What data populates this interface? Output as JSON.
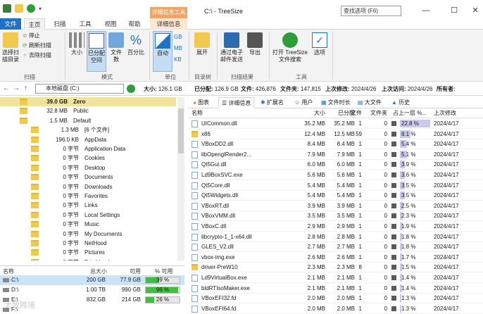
{
  "window": {
    "context_tab_title": "详细信息工具",
    "title": "C:\\ - TreeSize",
    "search_placeholder": "查找选项 (F6)"
  },
  "ribbon_tabs": [
    "文件",
    "主页",
    "扫描",
    "工具",
    "视图",
    "帮助",
    "详细信息"
  ],
  "ribbon": {
    "scan_group": {
      "label": "扫描",
      "select_dir": "选择扫描目录",
      "stop": "停止",
      "refresh": "刷新扫描",
      "unload": "去除扫描"
    },
    "mode_group": {
      "label": "模式",
      "size": "大小",
      "allocated": "已分配空间",
      "files": "文件数",
      "percent": "百分比"
    },
    "unit_group": {
      "label": "单位",
      "auto": "自动",
      "gb": "GB",
      "mb": "MB",
      "kb": "KB"
    },
    "tree_group": {
      "label": "目录树",
      "expand": "展开"
    },
    "export_group": {
      "label": "扫描结果",
      "email": "通过电子邮件发送",
      "export": "导出"
    },
    "tools_group": {
      "label": "工具",
      "open_search": "打开 TreeSize 文件搜索",
      "options": "选项"
    }
  },
  "addressbar": {
    "path": "本地磁盘 (C:)",
    "size": {
      "label": "大小:",
      "value": "126.1 GB"
    },
    "allocated": {
      "label": "已分配:",
      "value": "126.9 GB"
    },
    "files": {
      "label": "文件:",
      "value": "426,876"
    },
    "folders": {
      "label": "文件夹:",
      "value": "147,815"
    },
    "last_modified": {
      "label": "上次修改:",
      "value": "2024/4/26"
    },
    "last_access": {
      "label": "上次访问:",
      "value": "2024/4/26"
    },
    "owner": {
      "label": "所有者:"
    }
  },
  "tree": [
    {
      "size": "39.0 GB",
      "name": "Zero",
      "highlight": true
    },
    {
      "size": "32.8 MB",
      "name": "Public"
    },
    {
      "size": "1.5 MB",
      "name": "Default"
    },
    {
      "size": "1.3 MB",
      "name": "[6 个文件]"
    },
    {
      "size": "196.0 KB",
      "name": "AppData"
    },
    {
      "size": "0 字节",
      "name": "Application Data"
    },
    {
      "size": "0 字节",
      "name": "Cookies"
    },
    {
      "size": "0 字节",
      "name": "Desktop"
    },
    {
      "size": "0 字节",
      "name": "Documents"
    },
    {
      "size": "0 字节",
      "name": "Downloads"
    },
    {
      "size": "0 字节",
      "name": "Favorites"
    },
    {
      "size": "0 字节",
      "name": "Links"
    },
    {
      "size": "0 字节",
      "name": "Local Settings"
    },
    {
      "size": "0 字节",
      "name": "Music"
    },
    {
      "size": "0 字节",
      "name": "My Documents"
    },
    {
      "size": "0 字节",
      "name": "NetHood"
    },
    {
      "size": "0 字节",
      "name": "Pictures"
    },
    {
      "size": "0 字节",
      "name": "PrintHood"
    }
  ],
  "drives": {
    "headers": [
      "名称",
      "总大小",
      "可用",
      "% 可用"
    ],
    "rows": [
      {
        "name": "C:\\",
        "total": "200 GB",
        "free": "77.9 GB",
        "pct": "39 %",
        "fill": 0.39,
        "selected": true
      },
      {
        "name": "D:\\",
        "total": "1.00 TB",
        "free": "990 GB",
        "pct": "96 %",
        "fill": 0.96
      },
      {
        "name": "E:\\",
        "total": "832 GB",
        "free": "214 GB",
        "pct": "26 %",
        "fill": 0.26
      },
      {
        "name": "F:\\",
        "total": "",
        "free": "",
        "pct": "",
        "fill": 0
      }
    ]
  },
  "right_tabs": [
    "图表",
    "详细信息",
    "扩展名",
    "用户",
    "文件时长",
    "大文件",
    "历史"
  ],
  "columns": [
    "名称",
    "大小",
    "已分配",
    "文件",
    "文件夹",
    "占上一层 %...",
    "上次修改"
  ],
  "files": [
    {
      "name": "UICommon.dll",
      "size": "35.2 MB",
      "alloc": "35.2 MB",
      "files": "1",
      "folders": "0",
      "pct": "22.8 %",
      "pctv": 0.228,
      "date": "2024/4/17"
    },
    {
      "name": "x86",
      "size": "12.4 MB",
      "alloc": "12.5 MB",
      "files": "59",
      "folders": "0",
      "pct": "8.1 %",
      "pctv": 0.081,
      "date": "2024/4/17",
      "folder": true
    },
    {
      "name": "VBoxDD2.dll",
      "size": "8.4 MB",
      "alloc": "8.4 MB",
      "files": "1",
      "folders": "0",
      "pct": "5.4 %",
      "pctv": 0.054,
      "date": "2024/4/17"
    },
    {
      "name": "libOpenglRender2...",
      "size": "7.9 MB",
      "alloc": "7.9 MB",
      "files": "1",
      "folders": "0",
      "pct": "5.1 %",
      "pctv": 0.051,
      "date": "2024/4/17"
    },
    {
      "name": "Qt5Gui.dll",
      "size": "6.0 MB",
      "alloc": "6.0 MB",
      "files": "1",
      "folders": "0",
      "pct": "3.9 %",
      "pctv": 0.039,
      "date": "2024/4/17"
    },
    {
      "name": "Ld9BoxSVC.exe",
      "size": "5.6 MB",
      "alloc": "5.6 MB",
      "files": "1",
      "folders": "0",
      "pct": "3.6 %",
      "pctv": 0.036,
      "date": "2024/4/17"
    },
    {
      "name": "Qt5Core.dll",
      "size": "5.4 MB",
      "alloc": "5.4 MB",
      "files": "1",
      "folders": "0",
      "pct": "3.5 %",
      "pctv": 0.035,
      "date": "2024/4/17"
    },
    {
      "name": "Qt5Widgets.dll",
      "size": "5.4 MB",
      "alloc": "5.4 MB",
      "files": "1",
      "folders": "0",
      "pct": "3.5 %",
      "pctv": 0.035,
      "date": "2024/4/17"
    },
    {
      "name": "VBoxRT.dll",
      "size": "3.9 MB",
      "alloc": "3.9 MB",
      "files": "1",
      "folders": "0",
      "pct": "2.5 %",
      "pctv": 0.025,
      "date": "2024/4/17"
    },
    {
      "name": "VBoxVMM.dll",
      "size": "3.5 MB",
      "alloc": "3.5 MB",
      "files": "1",
      "folders": "0",
      "pct": "2.3 %",
      "pctv": 0.023,
      "date": "2024/4/17"
    },
    {
      "name": "VBoxC.dll",
      "size": "2.9 MB",
      "alloc": "2.9 MB",
      "files": "1",
      "folders": "0",
      "pct": "1.9 %",
      "pctv": 0.019,
      "date": "2024/4/17"
    },
    {
      "name": "libcrypto-1_1-x64.dll",
      "size": "2.8 MB",
      "alloc": "2.8 MB",
      "files": "1",
      "folders": "0",
      "pct": "1.8 %",
      "pctv": 0.018,
      "date": "2024/4/17"
    },
    {
      "name": "GLES_V2.dll",
      "size": "2.7 MB",
      "alloc": "2.7 MB",
      "files": "1",
      "folders": "0",
      "pct": "1.8 %",
      "pctv": 0.018,
      "date": "2024/4/17"
    },
    {
      "name": "vbox-img.exe",
      "size": "2.6 MB",
      "alloc": "2.6 MB",
      "files": "1",
      "folders": "0",
      "pct": "1.7 %",
      "pctv": 0.017,
      "date": "2024/4/17"
    },
    {
      "name": "driver-PreW10",
      "size": "2.3 MB",
      "alloc": "2.3 MB",
      "files": "8",
      "folders": "0",
      "pct": "1.5 %",
      "pctv": 0.015,
      "date": "2024/4/17",
      "folder": true
    },
    {
      "name": "Ld9VirtualBox.exe",
      "size": "2.1 MB",
      "alloc": "2.1 MB",
      "files": "1",
      "folders": "0",
      "pct": "1.4 %",
      "pctv": 0.014,
      "date": "2024/4/17"
    },
    {
      "name": "bldRTIsoMaker.exe",
      "size": "2.1 MB",
      "alloc": "2.1 MB",
      "files": "1",
      "folders": "0",
      "pct": "1.4 %",
      "pctv": 0.014,
      "date": "2024/4/17"
    },
    {
      "name": "VBoxEFI32.fd",
      "size": "2.0 MB",
      "alloc": "2.0 MB",
      "files": "1",
      "folders": "0",
      "pct": "1.3 %",
      "pctv": 0.013,
      "date": "2024/4/17"
    },
    {
      "name": "VBoxEFI64.fd",
      "size": "2.0 MB",
      "alloc": "2.0 MB",
      "files": "1",
      "folders": "0",
      "pct": "1.3 %",
      "pctv": 0.013,
      "date": "2024/4/17"
    }
  ],
  "watermark": "大致跨境"
}
